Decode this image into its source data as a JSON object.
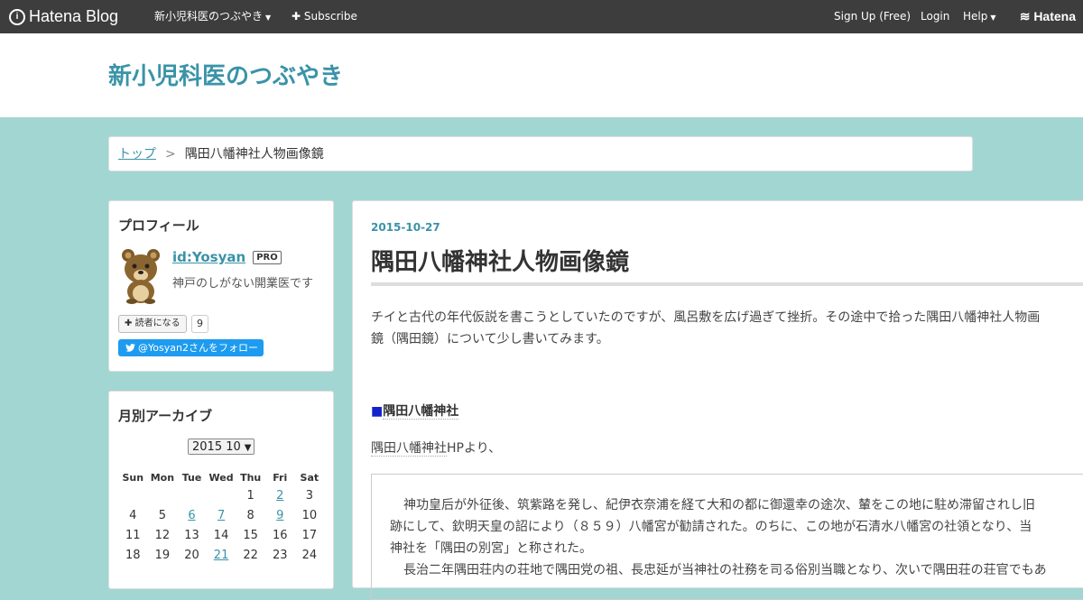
{
  "topbar": {
    "logo_text": "Hatena Blog",
    "blog_menu": "新小児科医のつぶやき",
    "subscribe": "Subscribe",
    "signup": "Sign Up (Free)",
    "login": "Login",
    "help": "Help",
    "hatena_logo": "Hatena"
  },
  "header": {
    "blog_title": "新小児科医のつぶやき"
  },
  "breadcrumb": {
    "top": "トップ",
    "separator": ">",
    "current": "隅田八幡神社人物画像鏡"
  },
  "profile": {
    "heading": "プロフィール",
    "id": "id:Yosyan",
    "badge": "PRO",
    "description": "神戸のしがない開業医です",
    "reader_button": "読者になる",
    "reader_count": "9",
    "twitter_follow": "@Yosyan2さんをフォロー"
  },
  "archive": {
    "heading": "月別アーカイブ",
    "selected_month": "2015 10",
    "weekdays": [
      "Sun",
      "Mon",
      "Tue",
      "Wed",
      "Thu",
      "Fri",
      "Sat"
    ],
    "rows": [
      [
        "",
        "",
        "",
        "",
        "1",
        "2",
        "3"
      ],
      [
        "4",
        "5",
        "6",
        "7",
        "8",
        "9",
        "10"
      ],
      [
        "11",
        "12",
        "13",
        "14",
        "15",
        "16",
        "17"
      ],
      [
        "18",
        "19",
        "20",
        "21",
        "22",
        "23",
        "24"
      ]
    ],
    "linked_days": [
      "2",
      "6",
      "7",
      "9",
      "21"
    ]
  },
  "article": {
    "date": "2015-10-27",
    "title": "隅田八幡神社人物画像鏡",
    "intro_line1": "チイと古代の年代仮説を書こうとしていたのですが、風呂敷を広げ過ぎて挫折。その途中で拾った隅田八幡神社人物画",
    "intro_line2": "鏡（隅田鏡）について少し書いてみます。",
    "section_mark": "■",
    "section_heading": "隅田八幡神社",
    "source_kw": "隅田八幡神社",
    "source_rest": "HPより、",
    "quote_line1": "神功皇后が外征後、筑紫路を発し、紀伊衣奈浦を経て大和の都に御還幸の途次、輦をこの地に駐め滞留されし旧",
    "quote_line2": "跡にして、欽明天皇の詔により（８５９）八幡宮が勧請された。のちに、この地が石清水八幡宮の社領となり、当",
    "quote_line3": "神社を「隅田の別宮」と称された。",
    "quote_line4": "長治二年隅田荘内の荘地で隅田党の祖、長忠延が当神社の社務を司る俗別当職となり、次いで隅田荘の荘官でもあ"
  }
}
